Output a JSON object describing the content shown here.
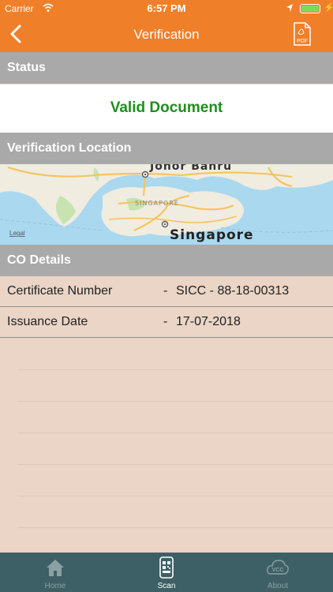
{
  "status_bar": {
    "carrier": "Carrier",
    "time": "6:57 PM"
  },
  "nav": {
    "title": "Verification",
    "pdf_label": "PDF"
  },
  "sections": {
    "status_header": "Status",
    "status_value": "Valid Document",
    "location_header": "Verification Location",
    "details_header": "CO Details"
  },
  "map": {
    "city_small": "SINGAPORE",
    "city_large": "Singapore",
    "north_label": "Johor Bahru",
    "legal": "Legal"
  },
  "details": [
    {
      "label": "Certificate Number",
      "separator": "-",
      "value": "SICC - 88-18-00313"
    },
    {
      "label": "Issuance Date",
      "separator": "-",
      "value": "17-07-2018"
    }
  ],
  "tabs": [
    {
      "label": "Home",
      "icon": "home-icon"
    },
    {
      "label": "Scan",
      "icon": "scan-icon"
    },
    {
      "label": "About",
      "icon": "vcc-cloud-icon"
    }
  ],
  "colors": {
    "accent": "#f07f2a",
    "valid": "#1e8e1e",
    "tabbar": "#3d6066",
    "header_gray": "#a9a9a9",
    "background": "#ead5c6"
  }
}
